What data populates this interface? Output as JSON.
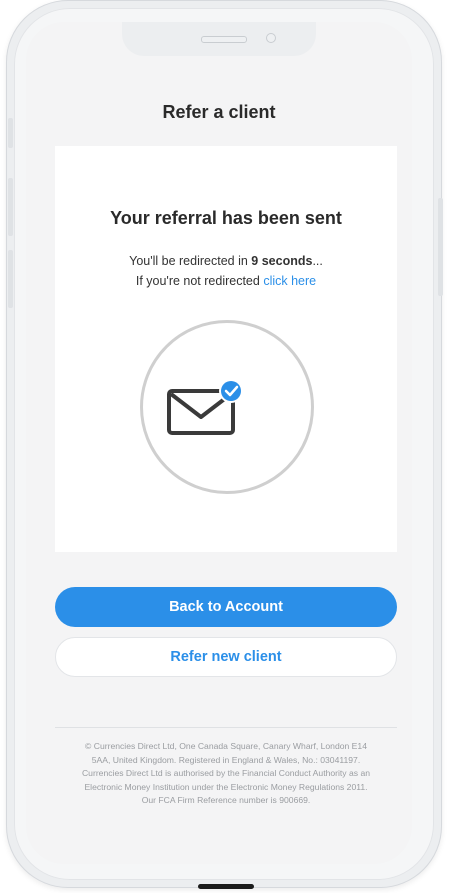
{
  "page": {
    "title": "Refer a client"
  },
  "confirmation": {
    "heading": "Your referral has been sent",
    "redirect_prefix": "You'll be redirected in ",
    "redirect_seconds": "9 seconds",
    "redirect_suffix": "...",
    "fallback_prefix": "If you're not redirected ",
    "fallback_link": "click here",
    "icon": "envelope-check-icon"
  },
  "actions": {
    "primary_label": "Back to Account",
    "secondary_label": "Refer new client"
  },
  "footer": {
    "lines": [
      "© Currencies Direct Ltd, One Canada Square, Canary Wharf, London E14",
      "5AA, United Kingdom. Registered in England & Wales, No.: 03041197.",
      "Currencies Direct Ltd is authorised by the Financial Conduct Authority as an",
      "Electronic Money Institution under the Electronic Money Regulations 2011.",
      "Our FCA Firm Reference number is 900669."
    ]
  },
  "colors": {
    "accent": "#2b8fe8",
    "text": "#2a2a2a",
    "muted": "#9a9da1",
    "background": "#f4f4f5"
  }
}
